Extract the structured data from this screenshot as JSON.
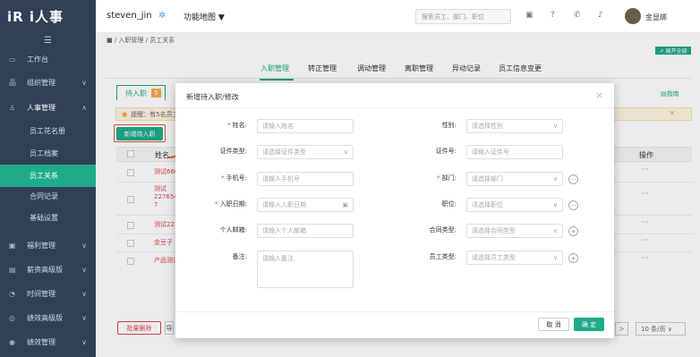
{
  "brand": {
    "logo": "iR i人事"
  },
  "sidebar": {
    "items": [
      {
        "icon": "monitor-icon",
        "label": "工作台"
      },
      {
        "icon": "org-icon",
        "label": "组织管理"
      },
      {
        "icon": "person-icon",
        "label": "人事管理"
      },
      {
        "icon": "gift-icon",
        "label": "福利管理"
      },
      {
        "icon": "salary-icon",
        "label": "薪资高级版"
      },
      {
        "icon": "clock-icon",
        "label": "时间管理"
      },
      {
        "icon": "chart-icon",
        "label": "绩效高级版"
      },
      {
        "icon": "target-icon",
        "label": "绩效管理"
      }
    ],
    "sub_items": [
      "员工花名册",
      "员工档案",
      "员工关系",
      "合同记录",
      "基础设置"
    ]
  },
  "topbar": {
    "username": "steven_jin",
    "map_label": "功能地图 ▼",
    "search_placeholder": "搜索员工、部门、职位",
    "display_name": "金显绑"
  },
  "breadcrumb": "■ / 入职管理 / 员工关系",
  "expand_label": "↗ 展开全部",
  "tabs": [
    "入职管理",
    "转正管理",
    "调动管理",
    "离职管理",
    "异动记录",
    "员工信息变更"
  ],
  "subtab": {
    "label": "待入职",
    "count": "5"
  },
  "guide_label": "指南",
  "tip": {
    "text": "提醒：有5名员工"
  },
  "add_button": "新增待入职",
  "table": {
    "header": {
      "name": "姓名",
      "op": "操作"
    },
    "rows": [
      "测试666",
      "测试\n227654\n7",
      "测试22",
      "金豆子",
      "产品测试"
    ]
  },
  "batch_delete": "批量删除",
  "more_label": "导",
  "pager": {
    "next": ">",
    "size": "10 条/页 ∨"
  },
  "modal": {
    "title": "新增待入职/修改",
    "close": "×",
    "fields": {
      "name_label": "姓名:",
      "name_ph": "请输入姓名",
      "gender_label": "性别:",
      "gender_ph": "请选择性别",
      "idtype_label": "证件类型:",
      "idtype_ph": "请选择证件类型",
      "idno_label": "证件号:",
      "idno_ph": "请输入证件号",
      "phone_label": "手机号:",
      "phone_ph": "请输入手机号",
      "dept_label": "部门:",
      "dept_ph": "请选择部门",
      "date_label": "入职日期:",
      "date_ph": "请输入入职日期",
      "pos_label": "职位:",
      "pos_ph": "请选择职位",
      "email_label": "个人邮箱:",
      "email_ph": "请输入个人邮箱",
      "contract_label": "合同类型:",
      "contract_ph": "请选择合同类型",
      "remark_label": "备注:",
      "remark_ph": "请输入备注",
      "emptype_label": "员工类型:",
      "emptype_ph": "请选择员工类型"
    },
    "cancel": "取 消",
    "ok": "确 定"
  },
  "colors": {
    "accent": "#1fab89",
    "sidebar": "#304156",
    "danger": "#e0464e",
    "warn": "#f0ad4e"
  }
}
